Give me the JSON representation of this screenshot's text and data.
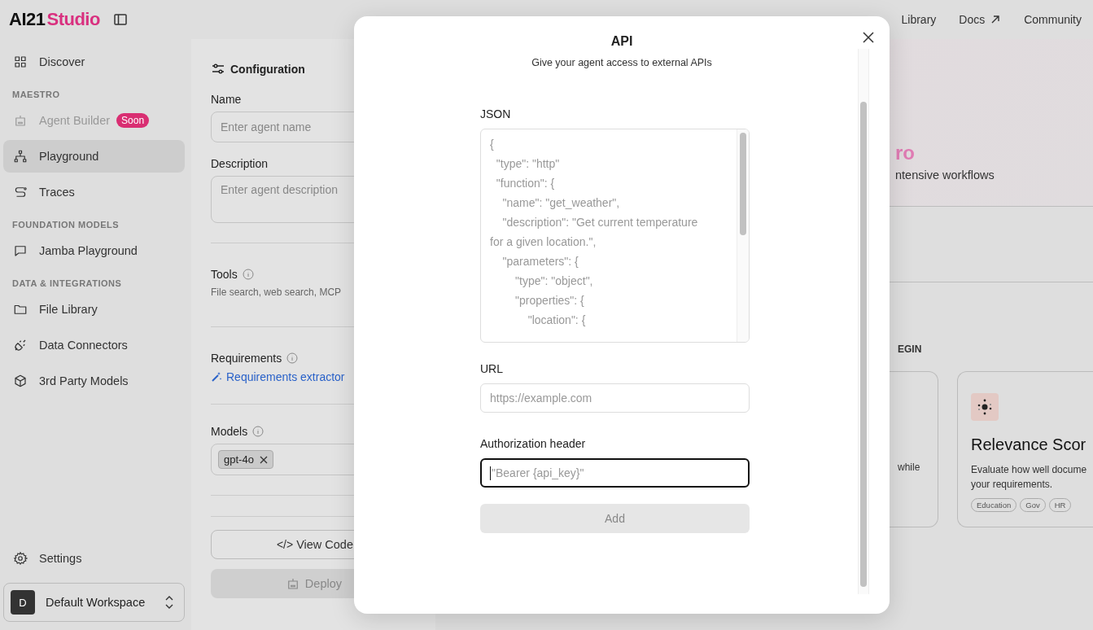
{
  "header": {
    "logo_primary": "AI21",
    "logo_secondary": "Studio",
    "nav": [
      {
        "label": "Library",
        "external": false
      },
      {
        "label": "Docs",
        "external": true
      },
      {
        "label": "Community",
        "external": false
      }
    ]
  },
  "sidebar": {
    "entries": [
      {
        "kind": "item",
        "label": "Discover",
        "selected": false,
        "disabled": false
      },
      {
        "kind": "section",
        "label": "MAESTRO"
      },
      {
        "kind": "item",
        "label": "Agent Builder",
        "badge": "Soon",
        "selected": false,
        "disabled": true
      },
      {
        "kind": "item",
        "label": "Playground",
        "selected": true,
        "disabled": false
      },
      {
        "kind": "item",
        "label": "Traces",
        "selected": false,
        "disabled": false
      },
      {
        "kind": "section",
        "label": "FOUNDATION MODELS"
      },
      {
        "kind": "item",
        "label": "Jamba Playground",
        "selected": false,
        "disabled": false
      },
      {
        "kind": "section",
        "label": "DATA & INTEGRATIONS"
      },
      {
        "kind": "item",
        "label": "File Library",
        "selected": false,
        "disabled": false
      },
      {
        "kind": "item",
        "label": "Data Connectors",
        "selected": false,
        "disabled": false
      },
      {
        "kind": "item",
        "label": "3rd Party Models",
        "selected": false,
        "disabled": false
      }
    ],
    "settings": "Settings",
    "workspace": {
      "initial": "D",
      "name": "Default Workspace"
    }
  },
  "configuration": {
    "title": "Configuration",
    "name": {
      "label": "Name",
      "placeholder": "Enter agent name"
    },
    "description": {
      "label": "Description",
      "placeholder": "Enter agent description"
    },
    "tools": {
      "label": "Tools",
      "hint": "File search, web search, MCP"
    },
    "requirements": {
      "label": "Requirements",
      "link": "Requirements extractor"
    },
    "models": {
      "label": "Models",
      "chips": [
        "gpt-4o"
      ]
    },
    "view_code": {
      "glyph": "</>",
      "label": "View Code"
    },
    "deploy": {
      "label": "Deploy",
      "disabled": true
    }
  },
  "background": {
    "hero_title": "ro",
    "hero_subtitle": "ntensive workflows",
    "section_label": "EGIN",
    "cards": [
      {
        "lines": [
          "while"
        ]
      },
      {
        "title": "Relevance Scor",
        "lines": [
          "Evaluate how well docume",
          "your requirements."
        ],
        "tags": [
          "Education",
          "Gov",
          "HR"
        ]
      }
    ]
  },
  "dialog": {
    "title": "API",
    "subtitle": "Give your agent access to external APIs",
    "json": {
      "label": "JSON",
      "placeholder_lines": [
        "{",
        "  \"type\": \"http\"",
        "  \"function\": {",
        "    \"name\": \"get_weather\",",
        "    \"description\": \"Get current temperature",
        "for a given location.\",",
        "    \"parameters\": {",
        "        \"type\": \"object\",",
        "        \"properties\": {",
        "            \"location\": {"
      ]
    },
    "url": {
      "label": "URL",
      "placeholder": "https://example.com",
      "focused": false
    },
    "auth": {
      "label": "Authorization header",
      "placeholder": "\"Bearer {api_key}\"",
      "focused": true
    },
    "add": {
      "label": "Add",
      "disabled": true
    }
  }
}
